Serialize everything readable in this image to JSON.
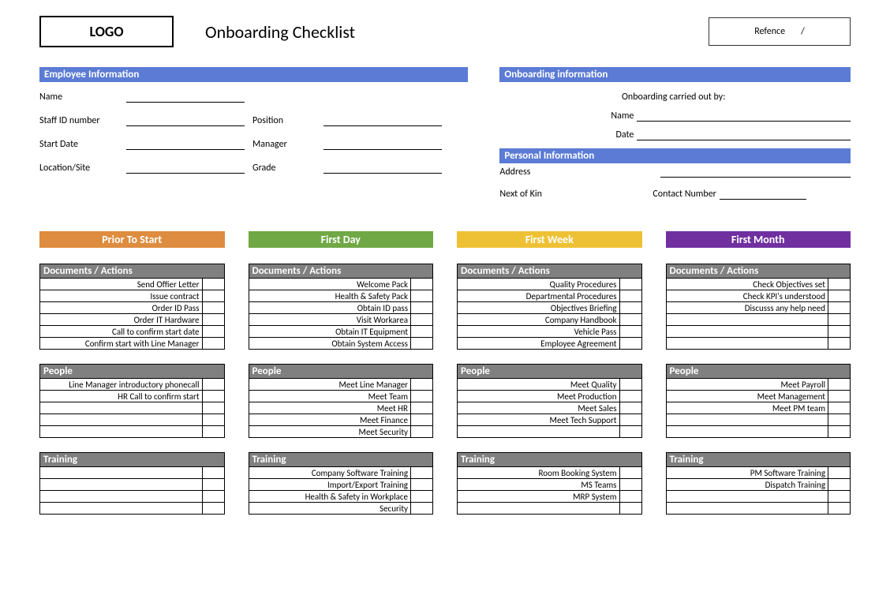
{
  "header": {
    "logo": "LOGO",
    "title": "Onboarding Checklist",
    "reference_label": "Refence",
    "reference_sep": "/"
  },
  "band_employee": "Employee Information",
  "band_onboarding": "Onboarding information",
  "band_personal": "Personal Information",
  "emp": {
    "name": "Name",
    "staffid": "Staff ID number",
    "position": "Position",
    "startdate": "Start Date",
    "manager": "Manager",
    "location": "Location/Site",
    "grade": "Grade"
  },
  "onb": {
    "carried": "Onboarding carried out by:",
    "name": "Name",
    "date": "Date"
  },
  "pers": {
    "address": "Address",
    "nok": "Next of Kin",
    "contact": "Contact Number"
  },
  "phases": [
    {
      "title": "Prior To Start",
      "class": "ph-orange"
    },
    {
      "title": "First Day",
      "class": "ph-green"
    },
    {
      "title": "First Week",
      "class": "ph-yellow"
    },
    {
      "title": "First Month",
      "class": "ph-purple"
    }
  ],
  "section_labels": {
    "docs": "Documents / Actions",
    "people": "People",
    "training": "Training"
  },
  "docs_rows": 6,
  "people_rows": 5,
  "training_rows": 4,
  "docs": [
    [
      "Send Offier Letter",
      "Issue contract",
      "Order ID Pass",
      "Order IT Hardware",
      "Call to confirm start date",
      "Confirm start with Line Manager"
    ],
    [
      "Welcome Pack",
      "Health & Safety Pack",
      "Obtain ID pass",
      "Visit Workarea",
      "Obtain IT Equipment",
      "Obtain System Access"
    ],
    [
      "Quality Procedures",
      "Departmental Procedures",
      "Objectives Briefing",
      "Company Handbook",
      "Vehicle Pass",
      "Employee Agreement"
    ],
    [
      "Check Objectives set",
      "Check KPI's understood",
      "Discusss any help need",
      "",
      "",
      ""
    ]
  ],
  "people": [
    [
      "Line Manager introductory phonecall",
      "HR Call to confirm start",
      "",
      "",
      ""
    ],
    [
      "Meet Line Manager",
      "Meet Team",
      "Meet HR",
      "Meet Finance",
      "Meet Security"
    ],
    [
      "Meet Quality",
      "Meet Production",
      "Meet Sales",
      "Meet Tech Support",
      ""
    ],
    [
      "Meet Payroll",
      "Meet Management",
      "Meet PM team",
      "",
      ""
    ]
  ],
  "training": [
    [
      "",
      "",
      "",
      ""
    ],
    [
      "Company Software Training",
      "Import/Export Training",
      "Health & Safety in Workplace",
      "Security"
    ],
    [
      "Room Booking System",
      "MS Teams",
      "MRP System",
      ""
    ],
    [
      "PM Software Training",
      "Dispatch Training",
      "",
      ""
    ]
  ]
}
